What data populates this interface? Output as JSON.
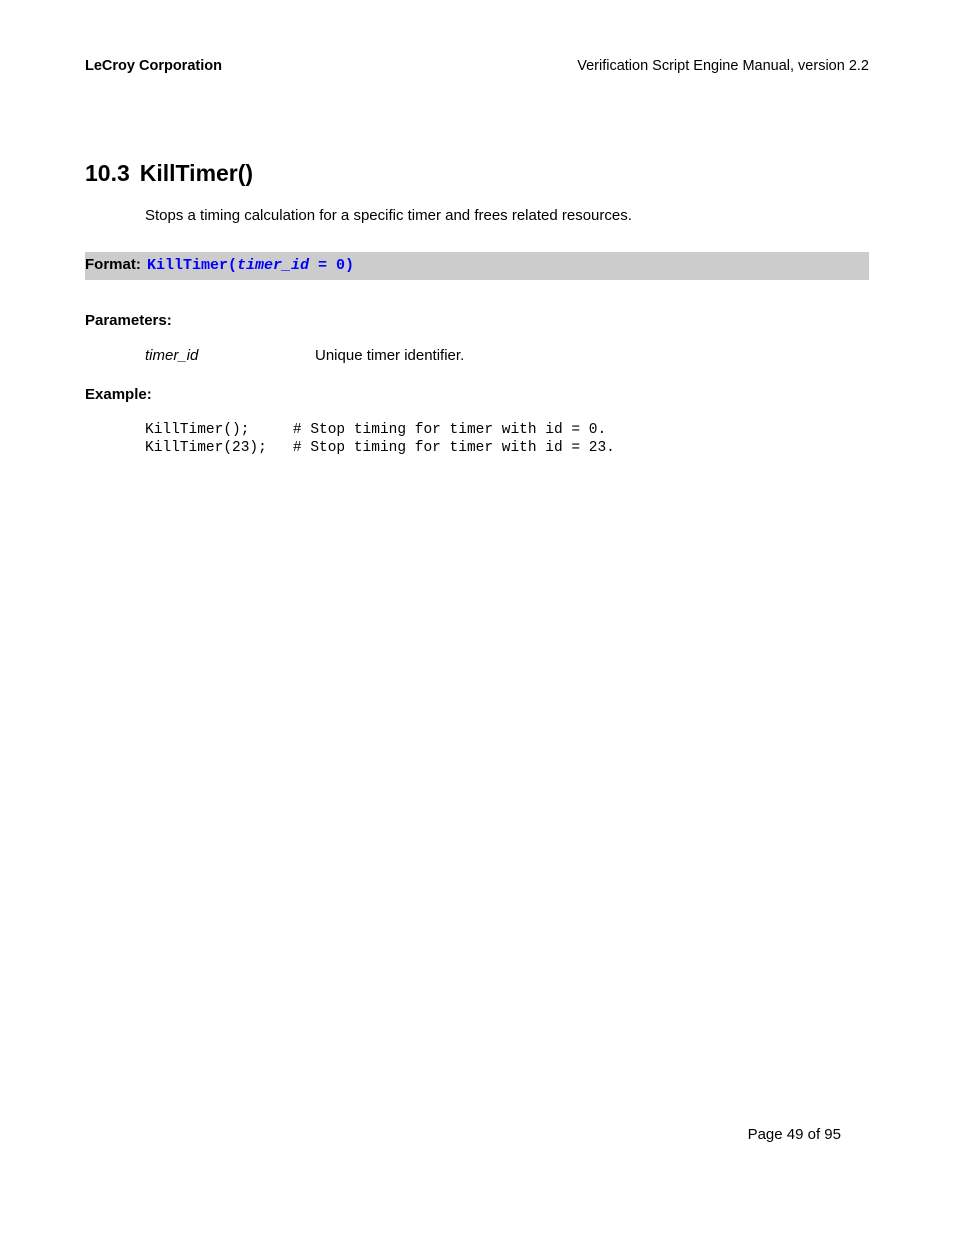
{
  "header": {
    "company": "LeCroy Corporation",
    "doc_title": "Verification Script Engine Manual, version 2.2"
  },
  "section": {
    "number": "10.3",
    "title": "KillTimer()",
    "description": "Stops a timing calculation for a specific timer and frees related resources."
  },
  "format": {
    "label": "Format:",
    "func_open": "KillTimer(",
    "param": "timer_id",
    "assign": " = 0)",
    "full_after_param": ""
  },
  "parameters": {
    "heading": "Parameters:",
    "items": [
      {
        "name": "timer_id",
        "desc": "Unique timer identifier."
      }
    ]
  },
  "example": {
    "heading": "Example:",
    "code": "KillTimer();     # Stop timing for timer with id = 0.\nKillTimer(23);   # Stop timing for timer with id = 23."
  },
  "footer": {
    "page_text": "Page 49 of 95"
  }
}
